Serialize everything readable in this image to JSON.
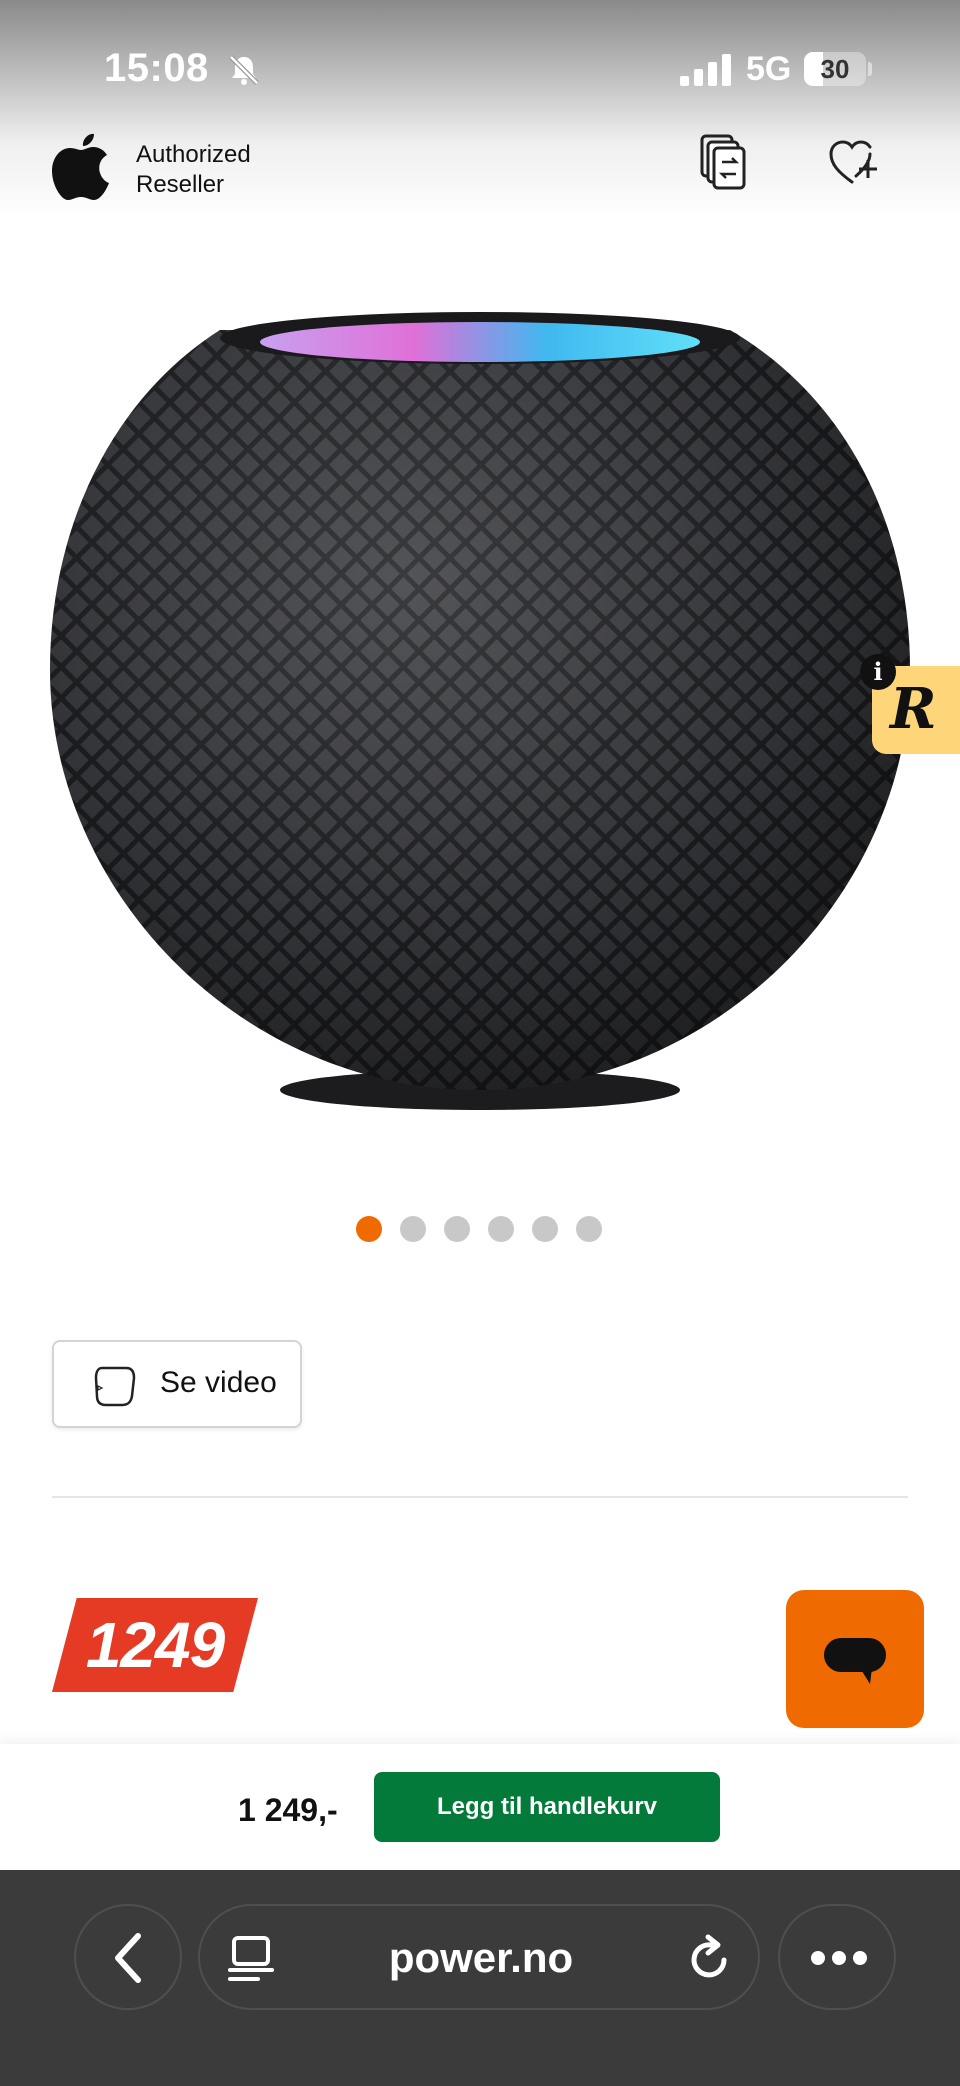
{
  "status": {
    "time": "15:08",
    "network": "5G",
    "battery": "30",
    "battery_level": 0.3,
    "icons": [
      "bell-muted-icon",
      "cellular-signal-icon",
      "battery-icon"
    ]
  },
  "header": {
    "reseller_line1": "Authorized",
    "reseller_line2": "Reseller",
    "icons": [
      "apple-logo-icon",
      "compare-icon",
      "wishlist-add-icon"
    ]
  },
  "product": {
    "image_name": "homepod-mini-space-gray",
    "gallery_count": 6,
    "gallery_active_index": 0,
    "video_label": "Se video",
    "price_tag": "1249"
  },
  "badge": {
    "letter": "R",
    "info": "i"
  },
  "buy_bar": {
    "price": "1 249,-",
    "add_to_cart": "Legg til handlekurv"
  },
  "browser": {
    "url": "power.no",
    "icons": [
      "back-icon",
      "reader-icon",
      "reload-icon",
      "more-icon"
    ]
  },
  "colors": {
    "accent_orange": "#ef6a00",
    "price_red": "#e53a24",
    "cart_green": "#037a3a",
    "toolbar": "#3b3b3b"
  }
}
